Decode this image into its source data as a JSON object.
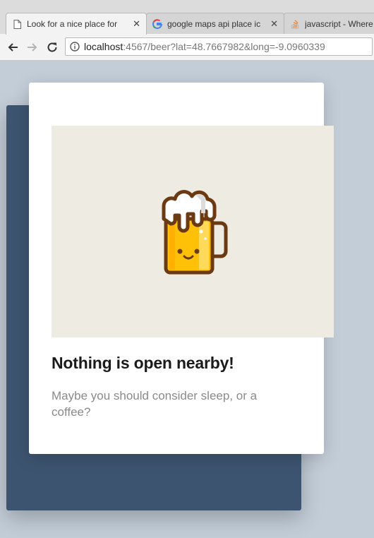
{
  "browser": {
    "tabs": [
      {
        "label": "Look for a nice place for",
        "icon": "page-icon",
        "active": true
      },
      {
        "label": "google maps api place ic",
        "icon": "google-icon",
        "active": false
      },
      {
        "label": "javascript - Where",
        "icon": "stackoverflow-icon",
        "active": false
      }
    ],
    "address_bar": {
      "host": "localhost",
      "path": ":4567/beer?lat=48.7667982&long=-9.0960339"
    }
  },
  "content": {
    "illustration": "beer-mug-icon",
    "title": "Nothing is open nearby!",
    "subtitle": "Maybe you should consider sleep, or a coffee?"
  },
  "colors": {
    "back_card": "#3d5470",
    "page_bg": "#c3cdd8",
    "hero_bg": "#eeebe2",
    "beer": "#ffc107",
    "outline": "#6b3a12"
  }
}
